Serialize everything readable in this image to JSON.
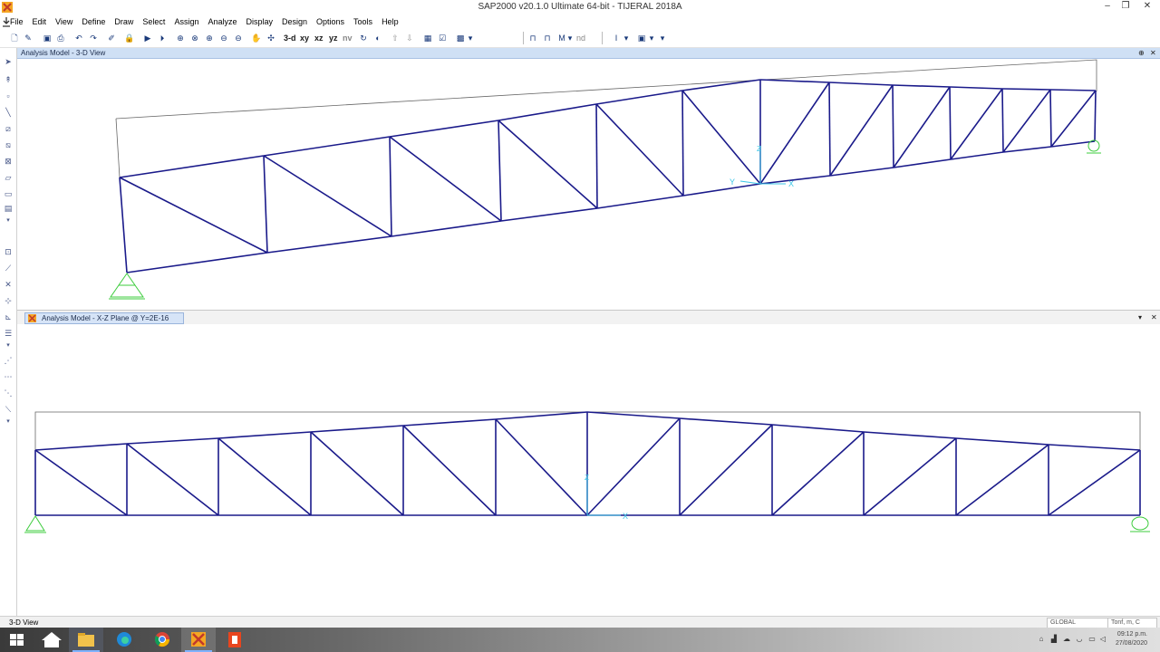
{
  "window": {
    "title": "SAP2000 v20.1.0 Ultimate 64-bit - TIJERAL 2018A",
    "minimize": "–",
    "restore": "❐",
    "close": "✕"
  },
  "menu": [
    "File",
    "Edit",
    "View",
    "Define",
    "Draw",
    "Select",
    "Assign",
    "Analyze",
    "Display",
    "Design",
    "Options",
    "Tools",
    "Help"
  ],
  "toolbar": {
    "view_3d": "3-d",
    "view_xy": "xy",
    "view_xz": "xz",
    "view_yz": "yz",
    "view_nv": "nv",
    "nd": "nd"
  },
  "views": {
    "top": {
      "title": "Analysis Model - 3-D View",
      "pin": "⊕",
      "close": "✕",
      "axis_y": "Y",
      "axis_x": "X",
      "axis_z": "Z"
    },
    "bottom": {
      "title": "Analysis Model - X-Z Plane @ Y=2E-16",
      "dropdown": "▾",
      "close": "✕",
      "axis_x": "X",
      "axis_z": "Z"
    }
  },
  "status": {
    "left": "3-D View",
    "coord_system": "GLOBAL",
    "units": "Tonf, m, C"
  },
  "taskbar": {
    "time": "09:12 p.m.",
    "date": "27/08/2020"
  },
  "colors": {
    "member": "#1a1a8a",
    "support": "#3ecc3e",
    "axis": "#3ac6e6",
    "title_bar_blue": "#cfe0f5"
  }
}
